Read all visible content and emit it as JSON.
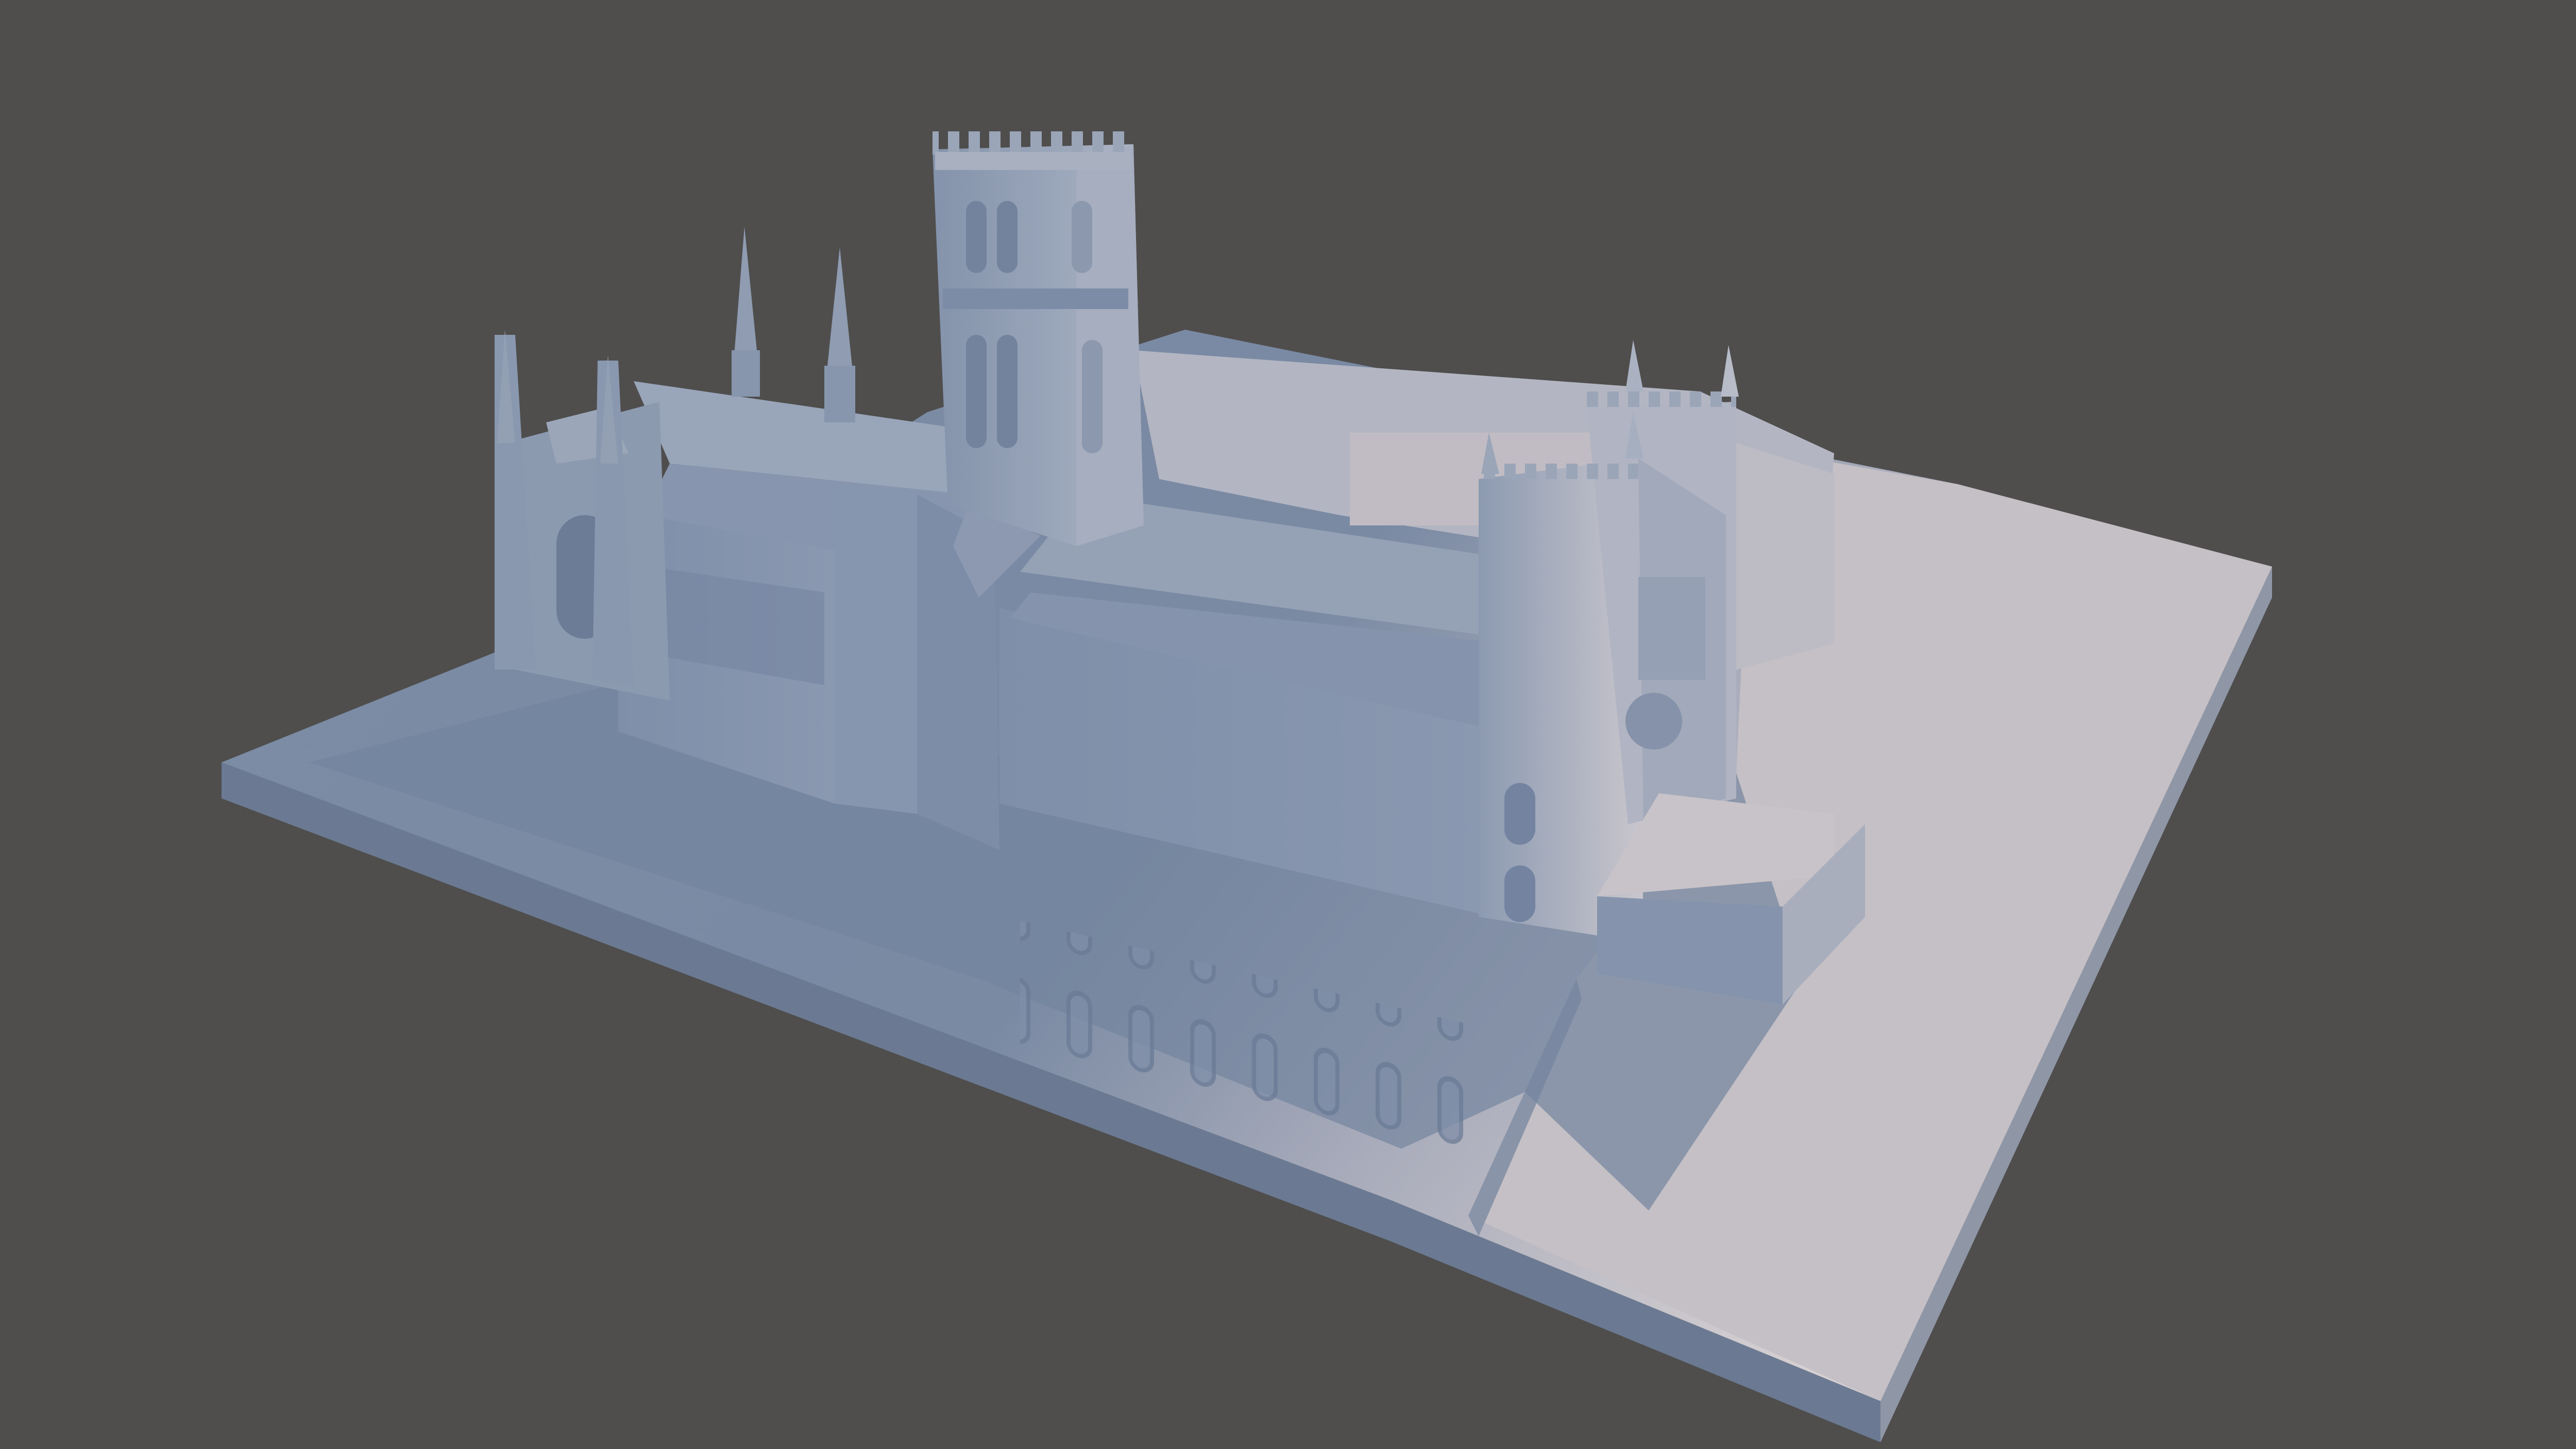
{
  "scene": {
    "subject": "cathedral-model-render",
    "colors": {
      "background": "#4f4e4d",
      "ground_top": "#7e8ea6",
      "ground_lit": "#c8c4c8",
      "ground_side": "#6f7d94",
      "wall_shadow": "#6e7f9a",
      "wall_mid": "#8594ac",
      "wall_lit": "#b9bdc8",
      "roof": "#96a2b6",
      "detail_dark": "#5d6c86",
      "warm_highlight": "#d9d1cf"
    }
  }
}
